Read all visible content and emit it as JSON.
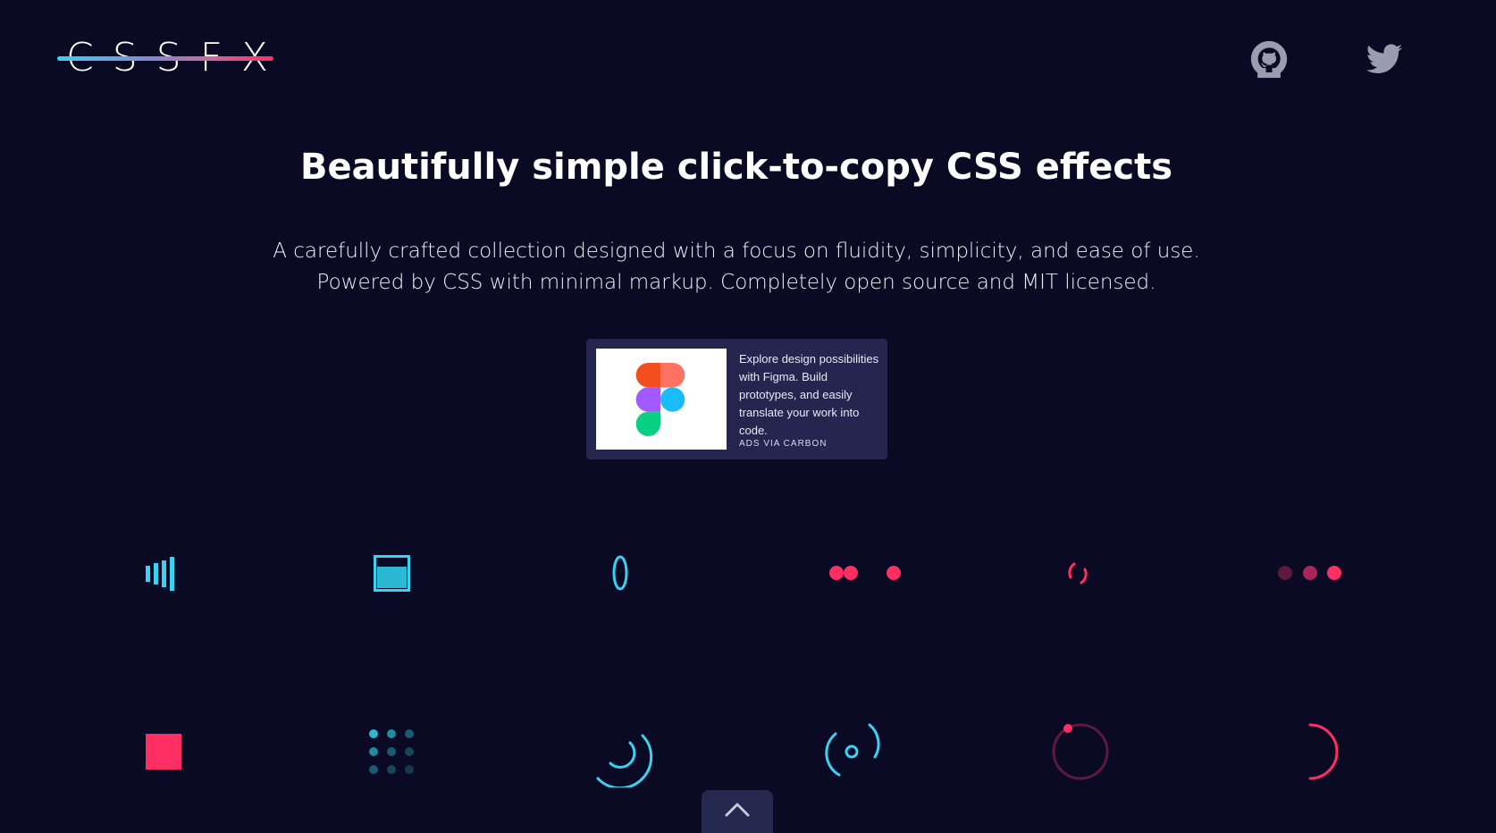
{
  "header": {
    "logo_text": "CSSFX",
    "github_icon": "github-icon",
    "twitter_icon": "twitter-icon"
  },
  "hero": {
    "title": "Beautifully simple click-to-copy CSS effects",
    "subtitle_line1": "A carefully crafted collection designed with a focus on fluidity, simplicity, and ease of use.",
    "subtitle_line2": "Powered by CSS with minimal markup. Completely open source and MIT licensed."
  },
  "ad": {
    "text": "Explore design possibilities with Figma. Build prototypes, and easily translate your work into code.",
    "via": "ADS VIA CARBON",
    "image_icon": "figma-logo"
  },
  "colors": {
    "background": "#0b0a24",
    "cyan": "#3ad2f0",
    "pink": "#ff2e63",
    "ad_bg": "#25264f"
  },
  "loaders": {
    "row1": [
      "bars-loader",
      "fill-box-loader",
      "spinning-ring-loader",
      "bouncing-dots-loader",
      "arc-spinner-loader",
      "fading-dots-loader"
    ],
    "row2": [
      "square-loader",
      "dot-grid-loader",
      "double-arc-loader",
      "orbit-loader",
      "dot-circle-loader",
      "half-circle-loader"
    ]
  },
  "scroll_top_icon": "chevron-up-icon"
}
